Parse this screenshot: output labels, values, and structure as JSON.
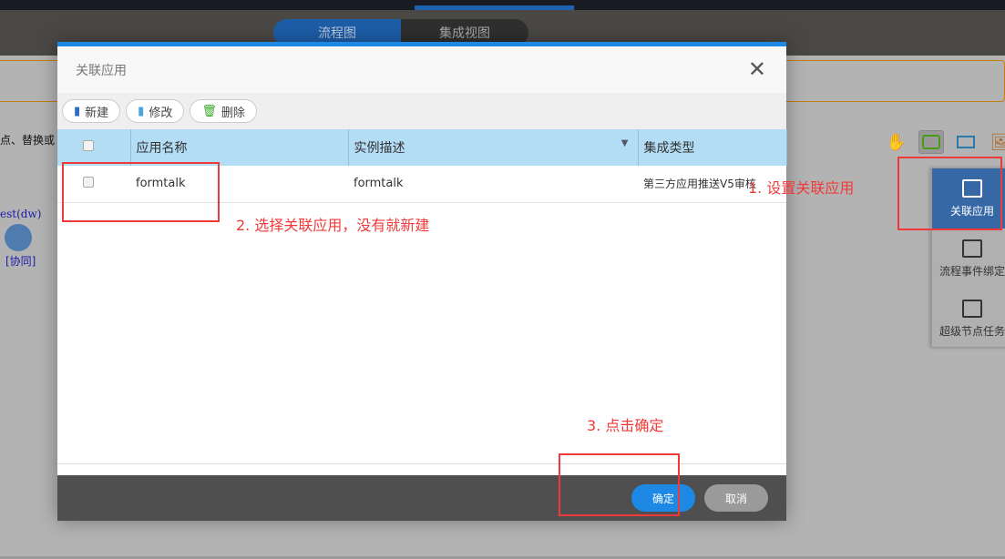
{
  "tabs": [
    "流程图",
    "集成视图"
  ],
  "background": {
    "text": "点、替换或",
    "user": "est(dw)",
    "role": "[协同]"
  },
  "right_panel": {
    "items": [
      {
        "label": "关联应用",
        "active": true
      },
      {
        "label": "流程事件绑定"
      },
      {
        "label": "超级节点任务"
      }
    ]
  },
  "dialog": {
    "title": "关联应用",
    "toolbar": {
      "new": "新建",
      "edit": "修改",
      "delete": "删除"
    },
    "columns": [
      "应用名称",
      "实例描述",
      "集成类型"
    ],
    "rows": [
      {
        "name": "formtalk",
        "desc": "formtalk",
        "type": "第三方应用推送V5审核"
      }
    ],
    "ok": "确定",
    "cancel": "取消"
  },
  "annotations": [
    "1. 设置关联应用",
    "2. 选择关联应用，没有就新建",
    "3. 点击确定"
  ],
  "colors": {
    "accent": "#1e88e5",
    "annotation": "#f03a3a",
    "header": "#b3dcf5"
  }
}
